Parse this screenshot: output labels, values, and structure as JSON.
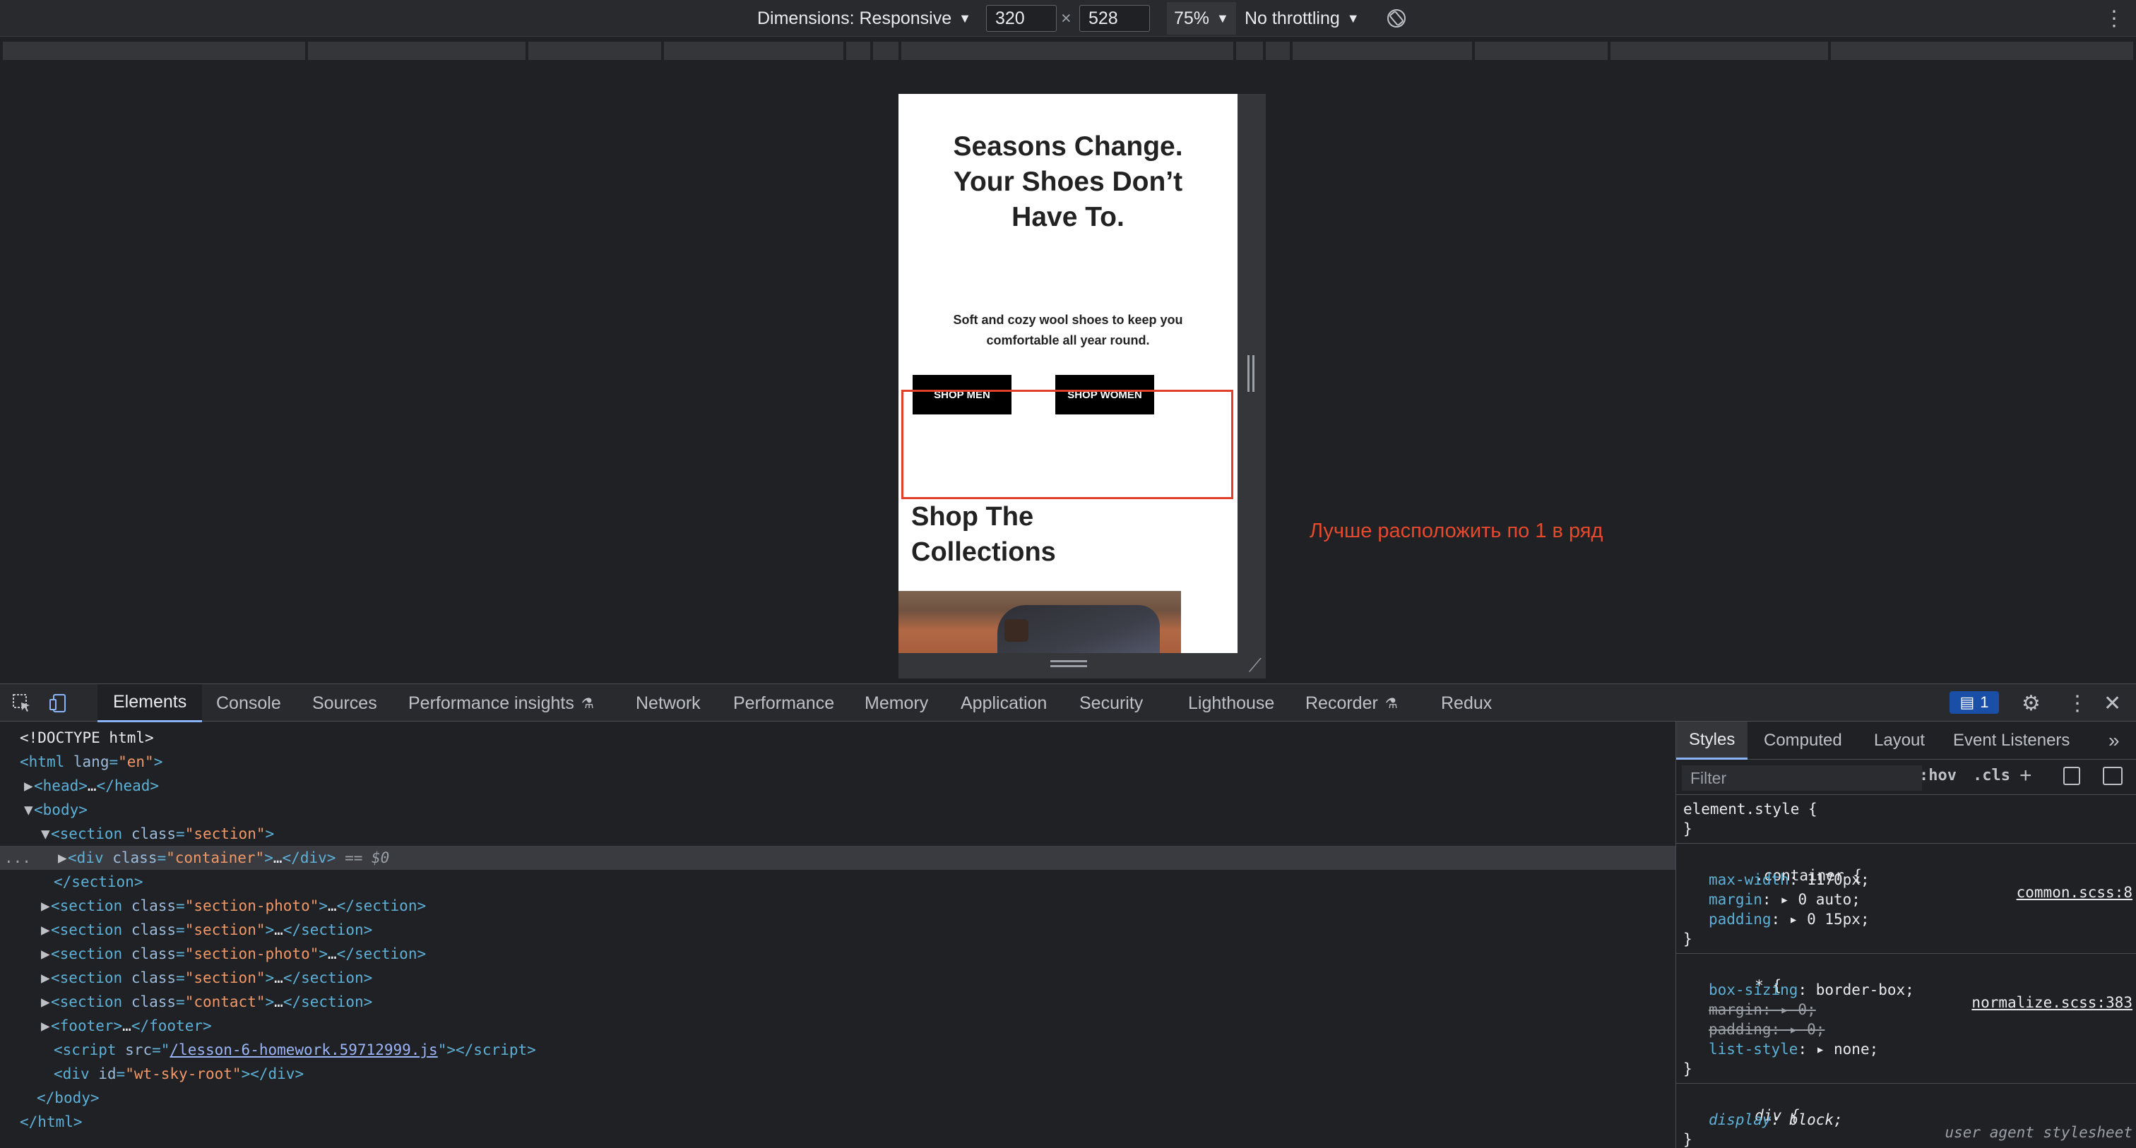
{
  "device_toolbar": {
    "dimensions_label": "Dimensions: Responsive",
    "width_value": "320",
    "times": "×",
    "height_value": "528",
    "zoom": "75%",
    "throttling": "No throttling",
    "rotate_icon": "rotate-icon",
    "more_icon": "more-vert-icon"
  },
  "page": {
    "hero_title": "Seasons Change. Your Shoes Don’t Have To.",
    "hero_subtitle": "Soft and cozy wool shoes to keep you comfortable all year round.",
    "shop_men": "SHOP MEN",
    "shop_women": "SHOP WOMEN",
    "collections_title": "Shop The Collections"
  },
  "annotation": {
    "text": "Лучше расположить по 1 в ряд",
    "color": "#e5492e"
  },
  "devtools": {
    "tabs": [
      "Elements",
      "Console",
      "Sources",
      "Performance insights",
      "Network",
      "Performance",
      "Memory",
      "Application",
      "Security",
      "Lighthouse",
      "Recorder",
      "Redux"
    ],
    "active_tab": "Elements",
    "issues_count": "1",
    "dom": {
      "doctype": "<!DOCTYPE html>",
      "html_open": "html",
      "html_lang_attr": "lang",
      "html_lang_val": "\"en\"",
      "head": "head",
      "body": "body",
      "section": "section",
      "class_attr": "class",
      "section_class": "\"section\"",
      "div": "div",
      "container_class": "\"container\"",
      "selected_suffix": "== $0",
      "section_photo_class": "\"section-photo\"",
      "contact_class": "\"contact\"",
      "footer": "footer",
      "script": "script",
      "src_attr": "src",
      "script_src": "/lesson-6-homework.59712999.js",
      "id_attr": "id",
      "wt_root": "\"wt-sky-root\"",
      "ellipsis": "…",
      "dots": "..."
    },
    "styles_tabs": [
      "Styles",
      "Computed",
      "Layout",
      "Event Listeners"
    ],
    "filter_placeholder": "Filter",
    "hov": ":hov",
    "cls": ".cls",
    "rules": {
      "element_style": "element.style {",
      "close": "}",
      "container_selector": ".container {",
      "container_src": "common.scss:8",
      "max_width": "max-width",
      "max_width_val": "1170px;",
      "margin": "margin",
      "margin_val": "0 auto;",
      "padding": "padding",
      "padding_val": "0 15px;",
      "universal_selector": "* {",
      "universal_src": "normalize.scss:383",
      "box_sizing": "box-sizing",
      "box_sizing_val": "border-box;",
      "margin_strike": "margin: ▸ 0;",
      "padding_strike": "padding: ▸ 0;",
      "list_style": "list-style",
      "list_style_val": "none;",
      "div_selector": "div {",
      "div_src": "user agent stylesheet",
      "display": "display",
      "display_val": "block;"
    }
  }
}
